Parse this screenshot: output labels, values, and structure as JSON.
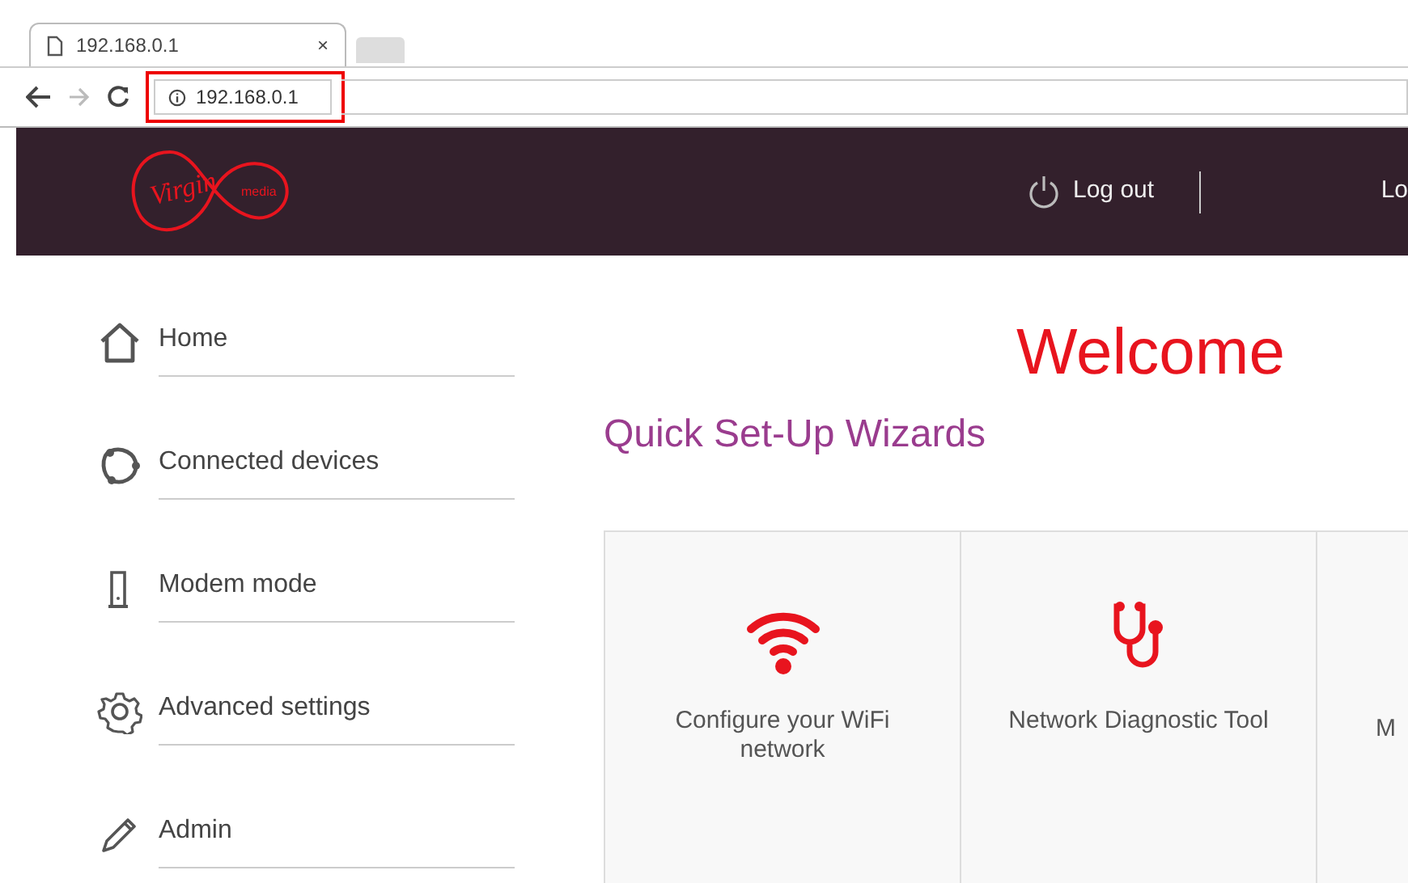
{
  "browser": {
    "tab": {
      "title": "192.168.0.1",
      "close": "×"
    },
    "address": "192.168.0.1",
    "forward_disabled": true
  },
  "header": {
    "logo": {
      "brand": "Virgin",
      "sub": "media"
    },
    "logout": "Log out",
    "cut_link": "Lo"
  },
  "sidebar": {
    "items": [
      {
        "label": "Home",
        "kind": "home"
      },
      {
        "label": "Connected devices",
        "kind": "devices"
      },
      {
        "label": "Modem mode",
        "kind": "modem"
      },
      {
        "label": "Advanced settings",
        "kind": "settings"
      },
      {
        "label": "Admin",
        "kind": "admin"
      }
    ]
  },
  "main": {
    "title": "Welcome",
    "section": "Quick Set-Up Wizards",
    "cards": [
      {
        "label": "Configure your WiFi network",
        "kind": "wifi"
      },
      {
        "label": "Network Diagnostic Tool",
        "kind": "stethoscope"
      },
      {
        "label": "M",
        "kind": "cut"
      }
    ]
  }
}
